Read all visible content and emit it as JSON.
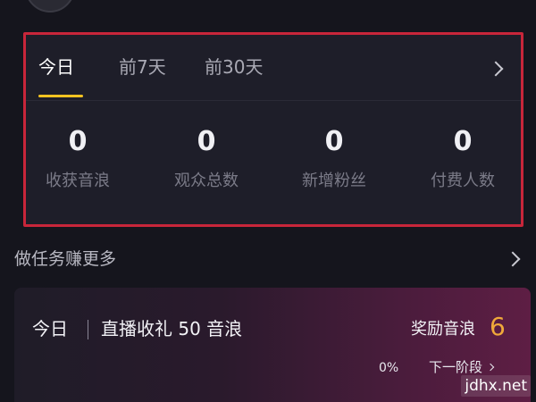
{
  "tabs": [
    {
      "label": "今日",
      "active": true
    },
    {
      "label": "前7天",
      "active": false
    },
    {
      "label": "前30天",
      "active": false
    }
  ],
  "stats": [
    {
      "value": "0",
      "label": "收获音浪"
    },
    {
      "value": "0",
      "label": "观众总数"
    },
    {
      "value": "0",
      "label": "新增粉丝"
    },
    {
      "value": "0",
      "label": "付费人数"
    }
  ],
  "tasks": {
    "title": "做任务赚更多"
  },
  "task_card": {
    "period": "今日",
    "description": "直播收礼 50 音浪",
    "reward_label": "奖励音浪",
    "reward_value": "6",
    "progress": "0%",
    "next_stage": "下一阶段"
  },
  "watermark": "jdhx.net",
  "colors": {
    "accent": "#f5c321",
    "highlight_border": "#c8263a",
    "reward": "#f0a93a",
    "background": "#15151d",
    "card": "#1e1e29"
  }
}
